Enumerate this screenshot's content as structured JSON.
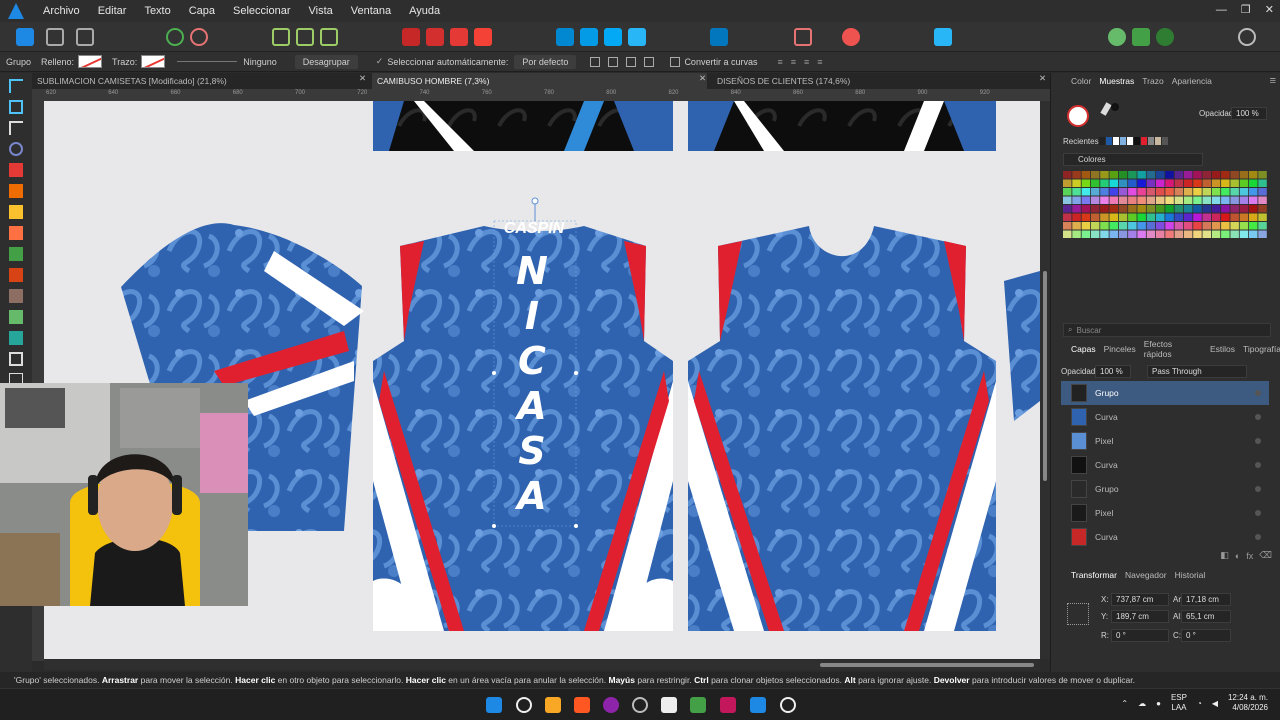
{
  "menu": [
    "Archivo",
    "Editar",
    "Texto",
    "Capa",
    "Seleccionar",
    "Vista",
    "Ventana",
    "Ayuda"
  ],
  "window_controls": [
    "—",
    "❐",
    "✕"
  ],
  "context": {
    "selection": "Grupo",
    "fill_label": "Relleno:",
    "stroke_label": "Trazo:",
    "stroke_value": "Ninguno",
    "ungroup": "Desagrupar",
    "auto_select_label": "Seleccionar automáticamente:",
    "auto_select_value": "Por defecto",
    "convert": "Convertir a curvas"
  },
  "tabs": [
    {
      "label": "SUBLIMACION CAMISETAS [Modificado] (21,8%)",
      "active": false
    },
    {
      "label": "CAMIBUSO HOMBRE (7,3%)",
      "active": true
    },
    {
      "label": "DISEÑOS DE CLIENTES (174,6%)",
      "active": false
    }
  ],
  "ruler_ticks": [
    "620",
    "640",
    "660",
    "680",
    "700",
    "720",
    "740",
    "760",
    "780",
    "800",
    "820",
    "840",
    "860",
    "880",
    "900",
    "920"
  ],
  "canvas": {
    "jersey_text_vertical": "NICASA",
    "jersey_logo": "CASPIN"
  },
  "status": {
    "selected": "'Grupo' seleccionados.",
    "k1": "Arrastrar",
    "t1": "para mover la selección.",
    "k2": "Hacer clic",
    "t2": "en otro objeto para seleccionarlo.",
    "k3": "Hacer clic",
    "t3": "en un área vacía para anular la selección.",
    "k4": "Mayús",
    "t4": "para restringir.",
    "k5": "Ctrl",
    "t5": "para clonar objetos seleccionados.",
    "k6": "Alt",
    "t6": "para ignorar ajuste.",
    "k7": "Devolver",
    "t7": "para introducir valores de mover o duplicar."
  },
  "panel": {
    "tabs_top": [
      "Color",
      "Muestras",
      "Trazo",
      "Apariencia"
    ],
    "active_top": "Muestras",
    "opacity_label": "Opacidad:",
    "opacity_value": "100 %",
    "recent_label": "Recientes:",
    "palette_name": "Colores",
    "search_placeholder": "Buscar",
    "tabs_layers": [
      "Capas",
      "Pinceles",
      "Efectos rápidos",
      "Estilos",
      "Tipografía"
    ],
    "layers_opacity_label": "Opacidad:",
    "layers_opacity_value": "100 %",
    "blend_mode": "Pass Through",
    "layers": [
      {
        "name": "Grupo",
        "selected": true
      },
      {
        "name": "Curva",
        "selected": false
      },
      {
        "name": "Pixel",
        "selected": false
      },
      {
        "name": "Curva",
        "selected": false
      },
      {
        "name": "Grupo",
        "selected": false
      },
      {
        "name": "Pixel",
        "selected": false
      },
      {
        "name": "Curva",
        "selected": false
      }
    ],
    "tabs_transform": [
      "Transformar",
      "Navegador",
      "Historial"
    ],
    "transform": {
      "x_label": "X:",
      "x": "737,87 cm",
      "y_label": "Y:",
      "y": "189,7 cm",
      "w_label": "An:",
      "w": "17,18 cm",
      "h_label": "Al:",
      "h": "65,1 cm",
      "r_label": "R:",
      "r": "0 °",
      "s_label": "C:",
      "s": "0 °"
    }
  },
  "tray": {
    "lang1": "ESP",
    "lang2": "LAA",
    "time": "12:24 a. m.",
    "date": "4/08/2026"
  },
  "colors": {
    "accent": "#3d5a80",
    "jersey_blue": "#2f63b0",
    "jersey_light": "#5b8fd4",
    "jersey_red": "#e0202e"
  }
}
